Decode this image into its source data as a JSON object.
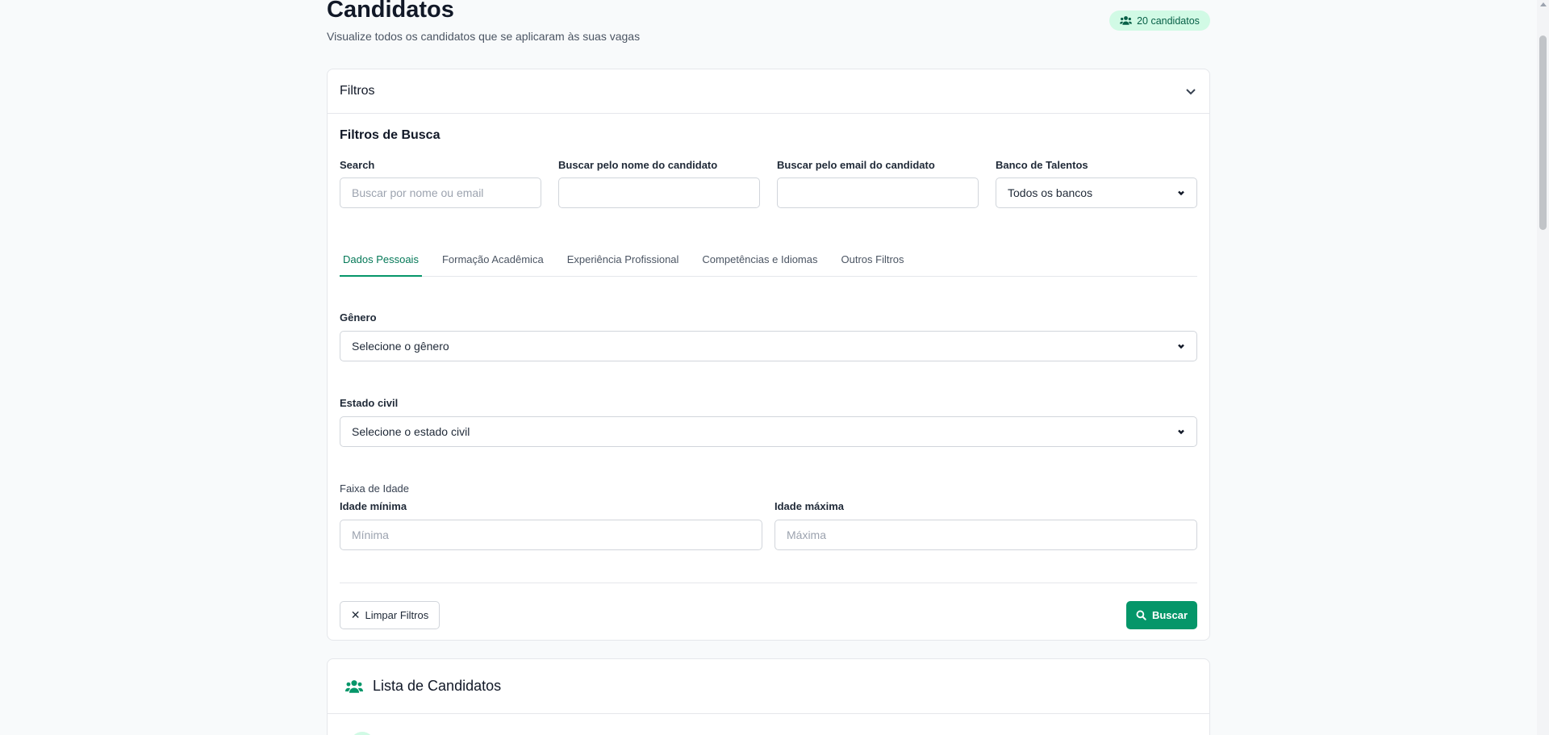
{
  "header": {
    "title": "Candidatos",
    "subtitle": "Visualize todos os candidatos que se aplicaram às suas vagas",
    "badge": "20 candidatos"
  },
  "filters": {
    "card_title": "Filtros",
    "section_title": "Filtros de Busca",
    "search": {
      "label": "Search",
      "placeholder": "Buscar por nome ou email",
      "value": ""
    },
    "name": {
      "label": "Buscar pelo nome do candidato",
      "value": ""
    },
    "email": {
      "label": "Buscar pelo email do candidato",
      "value": ""
    },
    "talent_bank": {
      "label": "Banco de Talentos",
      "selected": "Todos os bancos"
    },
    "tabs": [
      {
        "label": "Dados Pessoais",
        "active": true
      },
      {
        "label": "Formação Acadêmica",
        "active": false
      },
      {
        "label": "Experiência Profissional",
        "active": false
      },
      {
        "label": "Competências e Idiomas",
        "active": false
      },
      {
        "label": "Outros Filtros",
        "active": false
      }
    ],
    "gender": {
      "label": "Gênero",
      "selected": "Selecione o gênero"
    },
    "marital": {
      "label": "Estado civil",
      "selected": "Selecione o estado civil"
    },
    "age": {
      "group_label": "Faixa de Idade",
      "min_label": "Idade mínima",
      "min_placeholder": "Mínima",
      "max_label": "Idade máxima",
      "max_placeholder": "Máxima"
    },
    "clear_label": "Limpar Filtros",
    "search_label": "Buscar"
  },
  "list": {
    "title": "Lista de Candidatos"
  },
  "colors": {
    "accent": "#059669",
    "badge_bg": "#d1fae5",
    "badge_text": "#065f46"
  },
  "icons": {
    "badge": "users-icon",
    "collapse": "chevron-down-icon",
    "clear": "close-icon",
    "search": "search-icon",
    "list": "users-icon"
  }
}
